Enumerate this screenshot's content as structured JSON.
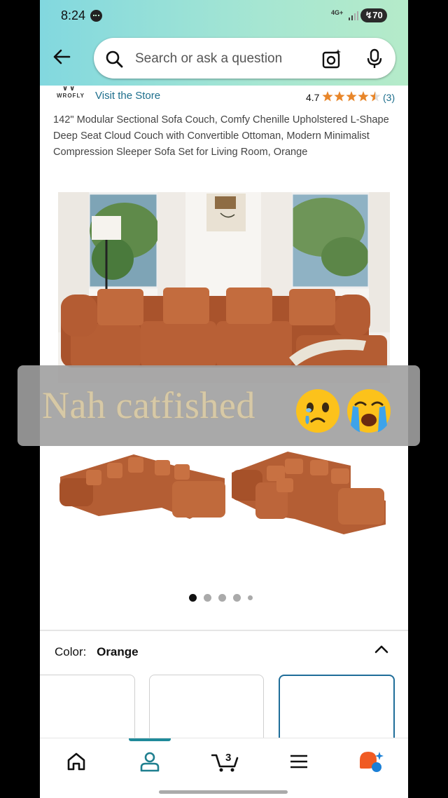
{
  "status_bar": {
    "time": "8:24",
    "network": "4G+",
    "battery": "70"
  },
  "search": {
    "placeholder": "Search or ask a question"
  },
  "store": {
    "logo_text": "WROFLY",
    "visit_label": "Visit the Store",
    "rating": "4.7",
    "rating_count": "(3)",
    "stars": 4.5
  },
  "product": {
    "title": "142\" Modular Sectional Sofa Couch, Comfy Chenille Upholstered L-Shape Deep Seat Cloud Couch with Convertible Ottoman, Modern Minimalist Compression Sleeper Sofa Set for Living Room, Orange"
  },
  "overlay": {
    "caption": "Nah catfished",
    "emojis": [
      "face-holding-back-tears",
      "loudly-crying-face"
    ]
  },
  "carousel": {
    "count": 5,
    "active_index": 0
  },
  "color": {
    "label": "Color:",
    "value": "Orange"
  },
  "swatches": {
    "count": 3,
    "selected_index": 2
  },
  "bottom_nav": {
    "items": [
      "home-icon",
      "account-icon",
      "cart-icon",
      "menu-icon",
      "ai-assistant-icon"
    ],
    "cart_count": "3",
    "active_index": 1
  },
  "colors": {
    "accent": "#1f8a9a",
    "link": "#1d6e8c",
    "sofa": "#b55f32",
    "star": "#e8862a",
    "selected_swatch": "#1f6d99"
  }
}
